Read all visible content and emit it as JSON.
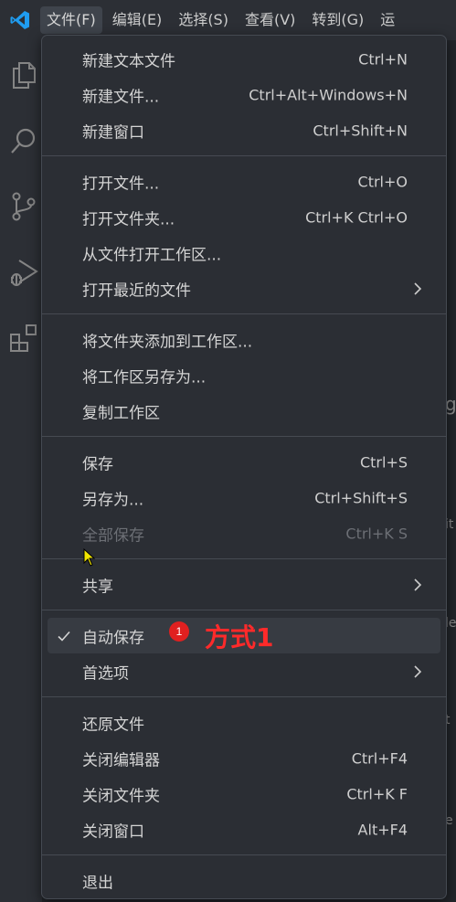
{
  "menubar": {
    "items": [
      "文件(F)",
      "编辑(E)",
      "选择(S)",
      "查看(V)",
      "转到(G)",
      "运"
    ]
  },
  "menu": {
    "groups": [
      [
        {
          "label": "新建文本文件",
          "shortcut": "Ctrl+N"
        },
        {
          "label": "新建文件...",
          "shortcut": "Ctrl+Alt+Windows+N"
        },
        {
          "label": "新建窗口",
          "shortcut": "Ctrl+Shift+N"
        }
      ],
      [
        {
          "label": "打开文件...",
          "shortcut": "Ctrl+O"
        },
        {
          "label": "打开文件夹...",
          "shortcut": "Ctrl+K Ctrl+O"
        },
        {
          "label": "从文件打开工作区...",
          "shortcut": ""
        },
        {
          "label": "打开最近的文件",
          "shortcut": "",
          "submenu": true
        }
      ],
      [
        {
          "label": "将文件夹添加到工作区...",
          "shortcut": ""
        },
        {
          "label": "将工作区另存为...",
          "shortcut": ""
        },
        {
          "label": "复制工作区",
          "shortcut": ""
        }
      ],
      [
        {
          "label": "保存",
          "shortcut": "Ctrl+S"
        },
        {
          "label": "另存为...",
          "shortcut": "Ctrl+Shift+S"
        },
        {
          "label": "全部保存",
          "shortcut": "Ctrl+K S",
          "disabled": true
        }
      ],
      [
        {
          "label": "共享",
          "shortcut": "",
          "submenu": true
        }
      ],
      [
        {
          "label": "自动保存",
          "shortcut": "",
          "checked": true,
          "highlight": true,
          "badge": "1",
          "annotation": "方式1"
        },
        {
          "label": "首选项",
          "shortcut": "",
          "submenu": true
        }
      ],
      [
        {
          "label": "还原文件",
          "shortcut": ""
        },
        {
          "label": "关闭编辑器",
          "shortcut": "Ctrl+F4"
        },
        {
          "label": "关闭文件夹",
          "shortcut": "Ctrl+K F"
        },
        {
          "label": "关闭窗口",
          "shortcut": "Alt+F4"
        }
      ],
      [
        {
          "label": "退出",
          "shortcut": ""
        }
      ]
    ]
  },
  "edge_letters": [
    "g",
    "it",
    "le",
    "t",
    "e"
  ],
  "colors": {
    "accent_logo": "#1f9cf0",
    "badge": "#e02020",
    "annotation": "#ff2a2a"
  }
}
